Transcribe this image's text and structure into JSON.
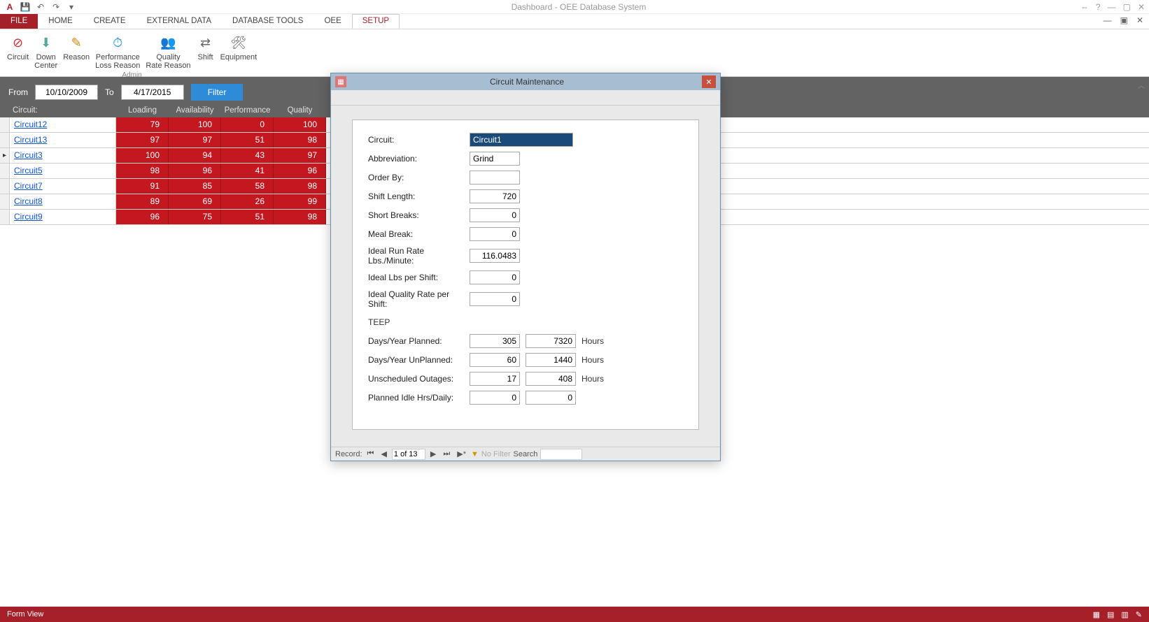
{
  "app": {
    "title": "Dashboard - OEE Database System"
  },
  "qat": {
    "save": "💾",
    "undo": "↶",
    "redo": "↷"
  },
  "tabs": [
    "FILE",
    "HOME",
    "CREATE",
    "EXTERNAL DATA",
    "DATABASE TOOLS",
    "OEE",
    "SETUP"
  ],
  "ribbon": {
    "buttons": [
      {
        "label": "Circuit"
      },
      {
        "label": "Down\nCenter"
      },
      {
        "label": "Reason"
      },
      {
        "label": "Performance\nLoss Reason"
      },
      {
        "label": "Quality\nRate Reason"
      },
      {
        "label": "Shift"
      },
      {
        "label": "Equipment"
      }
    ],
    "group_label": "Admin"
  },
  "filter": {
    "from_label": "From",
    "from": "10/10/2009",
    "to_label": "To",
    "to": "4/17/2015",
    "button": "Filter"
  },
  "grid": {
    "headers": [
      "Circuit:",
      "Loading",
      "Availability",
      "Performance",
      "Quality"
    ],
    "rows": [
      {
        "sel": "",
        "name": "Circuit12",
        "vals": [
          "79",
          "100",
          "0",
          "100"
        ]
      },
      {
        "sel": "",
        "name": "Circuit13",
        "vals": [
          "97",
          "97",
          "51",
          "98"
        ]
      },
      {
        "sel": "▸",
        "name": "Circuit3",
        "vals": [
          "100",
          "94",
          "43",
          "97"
        ]
      },
      {
        "sel": "",
        "name": "Circuit5",
        "vals": [
          "98",
          "96",
          "41",
          "96"
        ]
      },
      {
        "sel": "",
        "name": "Circuit7",
        "vals": [
          "91",
          "85",
          "58",
          "98"
        ]
      },
      {
        "sel": "",
        "name": "Circuit8",
        "vals": [
          "89",
          "69",
          "26",
          "99"
        ]
      },
      {
        "sel": "",
        "name": "Circuit9",
        "vals": [
          "96",
          "75",
          "51",
          "98"
        ]
      }
    ]
  },
  "modal": {
    "title": "Circuit Maintenance",
    "fields": {
      "circuit_lbl": "Circuit:",
      "circuit": "Circuit1",
      "abbrev_lbl": "Abbreviation:",
      "abbrev": "Grind",
      "order_lbl": "Order By:",
      "order": "",
      "shiftlen_lbl": "Shift Length:",
      "shiftlen": "720",
      "shortbrk_lbl": "Short Breaks:",
      "shortbrk": "0",
      "mealbrk_lbl": "Meal Break:",
      "mealbrk": "0",
      "idealrun_lbl": "Ideal Run Rate Lbs./Minute:",
      "idealrun": "116.0483",
      "ideallbs_lbl": "Ideal Lbs per Shift:",
      "ideallbs": "0",
      "idealqr_lbl": "Ideal Quality Rate per Shift:",
      "idealqr": "0",
      "teep": "TEEP",
      "dyp_lbl": "Days/Year Planned:",
      "dyp1": "305",
      "dyp2": "7320",
      "dyu_lbl": "Days/Year UnPlanned:",
      "dyu1": "60",
      "dyu2": "1440",
      "uo_lbl": "Unscheduled Outages:",
      "uo1": "17",
      "uo2": "408",
      "pih_lbl": "Planned Idle Hrs/Daily:",
      "pih1": "0",
      "pih2": "0",
      "hours": "Hours"
    },
    "nav": {
      "record": "Record:",
      "pos": "1 of 13",
      "nofilter": "No Filter",
      "search": "Search"
    }
  },
  "status": {
    "left": "Form View"
  }
}
